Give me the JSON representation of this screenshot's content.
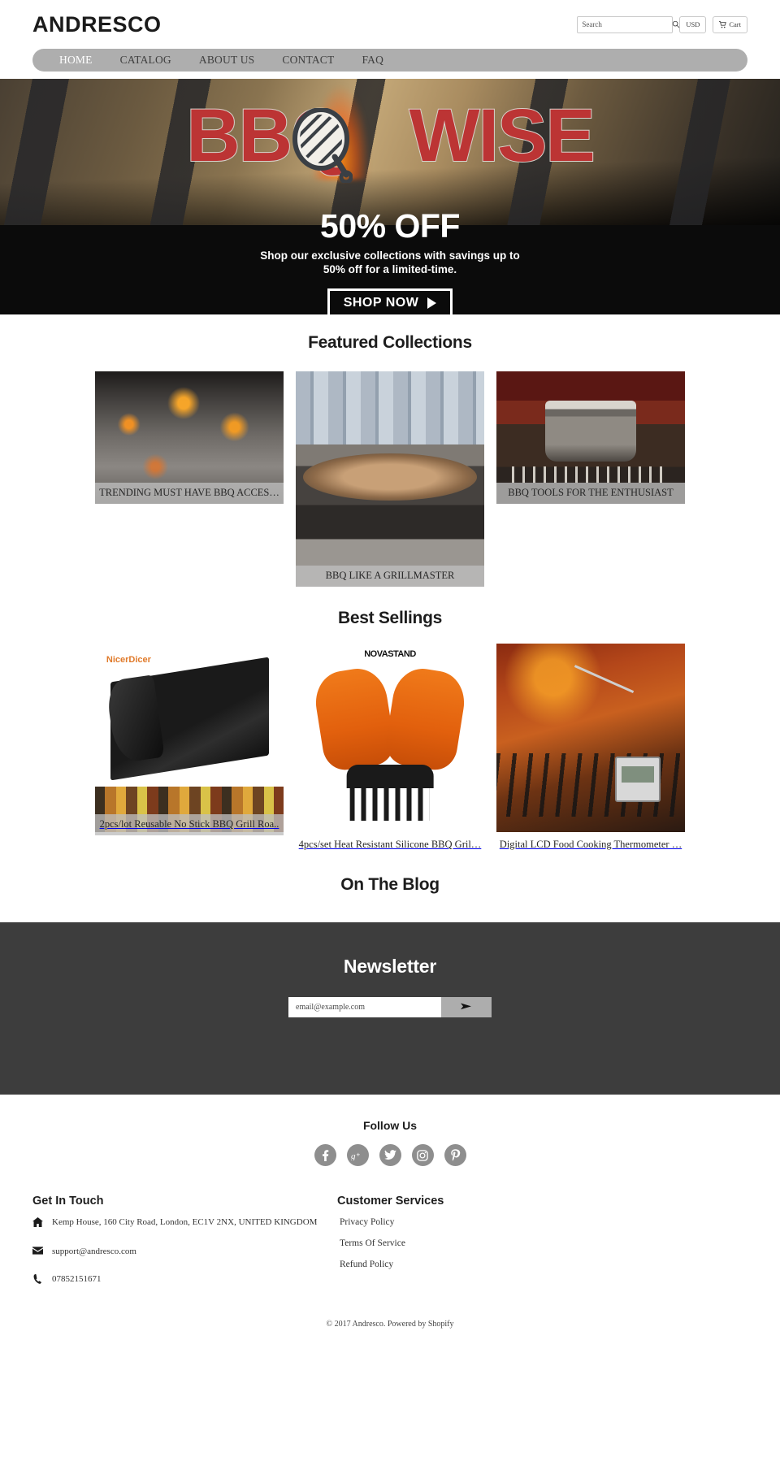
{
  "header": {
    "brand": "ANDRESCO",
    "search": {
      "placeholder": "Search",
      "value": "",
      "icon": "search-icon"
    },
    "currency_label": "USD",
    "cart_label": "Cart",
    "cart_icon": "cart-icon"
  },
  "nav": {
    "items": [
      {
        "label": "HOME",
        "active": true
      },
      {
        "label": "CATALOG",
        "active": false
      },
      {
        "label": "ABOUT US",
        "active": false
      },
      {
        "label": "CONTACT",
        "active": false
      },
      {
        "label": "FAQ",
        "active": false
      }
    ]
  },
  "hero": {
    "logo_left": "BBQ",
    "logo_right": "WISE",
    "headline": "50% OFF",
    "subtext_line1": "Shop our exclusive collections with savings up to",
    "subtext_line2": "50% off for a limited-time.",
    "cta": "SHOP NOW"
  },
  "featured": {
    "title": "Featured Collections",
    "cards": [
      {
        "caption": "TRENDING MUST HAVE BBQ ACCES…"
      },
      {
        "caption": "BBQ LIKE A GRILLMASTER"
      },
      {
        "caption": "BBQ TOOLS FOR THE ENTHUSIAST"
      }
    ]
  },
  "best": {
    "title": "Best Sellings",
    "products": [
      {
        "title": "2pcs/lot Reusable No Stick BBQ Grill Roa..",
        "brand": "NicerDicer"
      },
      {
        "title": "4pcs/set Heat Resistant Silicone BBQ Gril…",
        "brand": "NOVASTAND"
      },
      {
        "title": "Digital LCD Food Cooking Thermometer …",
        "brand": ""
      }
    ]
  },
  "blog": {
    "title": "On The Blog"
  },
  "newsletter": {
    "title": "Newsletter",
    "placeholder": "email@example.com",
    "value": "",
    "submit_icon": "send-arrow-icon"
  },
  "footer": {
    "follow_title": "Follow Us",
    "socials": [
      {
        "name": "facebook-icon"
      },
      {
        "name": "google-plus-icon"
      },
      {
        "name": "twitter-icon"
      },
      {
        "name": "instagram-icon"
      },
      {
        "name": "pinterest-icon"
      }
    ],
    "get_in_touch": {
      "title": "Get In Touch",
      "address": "Kemp House, 160 City Road, London, EC1V 2NX, UNITED KINGDOM",
      "email": "support@andresco.com",
      "phone": "07852151671"
    },
    "customer_services": {
      "title": "Customer Services",
      "links": [
        "Privacy Policy",
        "Terms Of Service",
        "Refund Policy"
      ]
    },
    "copyright": "© 2017 Andresco. Powered by Shopify"
  },
  "colors": {
    "nav_bar": "#aeaeae",
    "hero_red": "#bc3434",
    "newsletter_bg": "#3d3d3d",
    "social_bg": "#8e8e8e"
  }
}
